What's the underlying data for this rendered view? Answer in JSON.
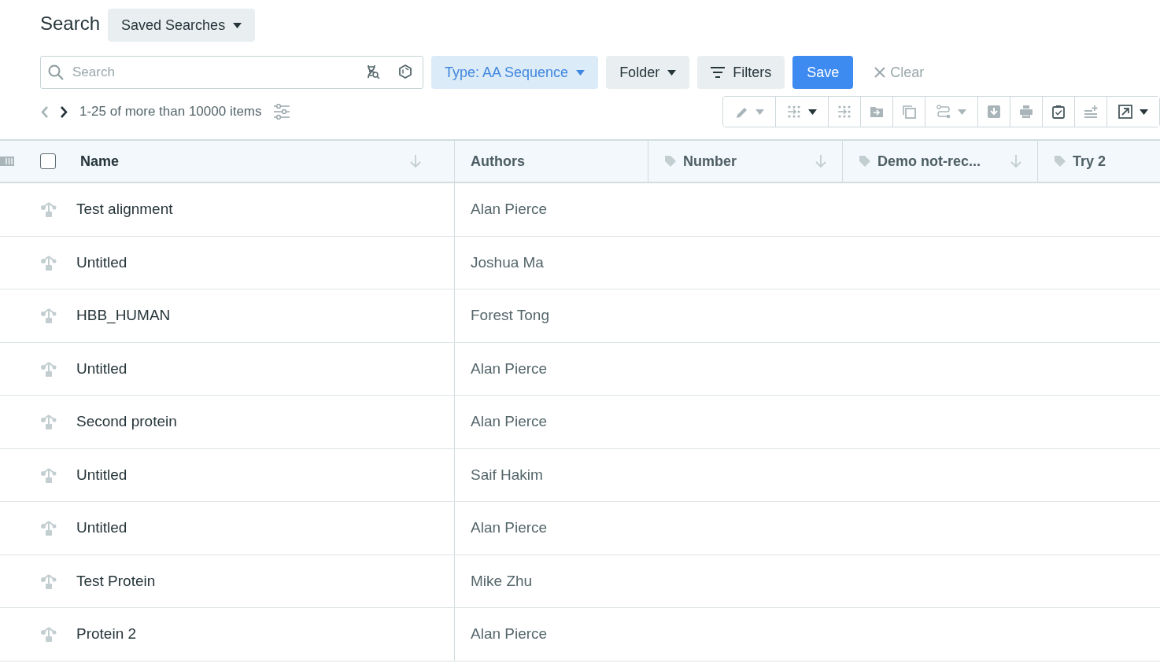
{
  "header": {
    "title": "Search",
    "saved_searches": "Saved Searches"
  },
  "search": {
    "placeholder": "Search"
  },
  "filters": {
    "type": "Type: AA Sequence",
    "folder": "Folder",
    "filters": "Filters",
    "save": "Save",
    "clear": "Clear"
  },
  "pagination": {
    "prev_disabled": true,
    "next_disabled": false,
    "summary": "1-25 of more than 10000 items"
  },
  "toolbar": [
    {
      "disabled": true,
      "dropdown": true
    },
    {
      "disabled": true,
      "dropdown": true
    },
    {
      "disabled": true,
      "dropdown": false
    },
    {
      "disabled": true,
      "dropdown": false
    },
    {
      "disabled": true,
      "dropdown": false
    },
    {
      "disabled": true,
      "dropdown": true
    },
    {
      "disabled": true,
      "dropdown": false
    },
    {
      "disabled": true,
      "dropdown": false
    },
    {
      "disabled": false,
      "dropdown": false
    },
    {
      "disabled": true,
      "dropdown": false
    },
    {
      "disabled": false,
      "dropdown": true
    }
  ],
  "table": {
    "select_all_checked": false,
    "columns": [
      {
        "label": "Name",
        "tagged": false,
        "sortable": true
      },
      {
        "label": "Authors",
        "tagged": false,
        "sortable": false
      },
      {
        "label": "Number",
        "tagged": true,
        "sortable": true
      },
      {
        "label": "Demo not-rec...",
        "tagged": true,
        "sortable": true
      },
      {
        "label": "Try 2",
        "tagged": true,
        "sortable": false
      }
    ],
    "rows": [
      {
        "name": "Test alignment",
        "authors": "Alan Pierce"
      },
      {
        "name": "Untitled",
        "authors": "Joshua Ma"
      },
      {
        "name": "HBB_HUMAN",
        "authors": "Forest Tong"
      },
      {
        "name": "Untitled",
        "authors": "Alan Pierce"
      },
      {
        "name": "Second protein",
        "authors": "Alan Pierce"
      },
      {
        "name": "Untitled",
        "authors": "Saif Hakim"
      },
      {
        "name": "Untitled",
        "authors": "Alan Pierce"
      },
      {
        "name": "Test Protein",
        "authors": "Mike Zhu"
      },
      {
        "name": "Protein 2",
        "authors": "Alan Pierce"
      }
    ]
  }
}
